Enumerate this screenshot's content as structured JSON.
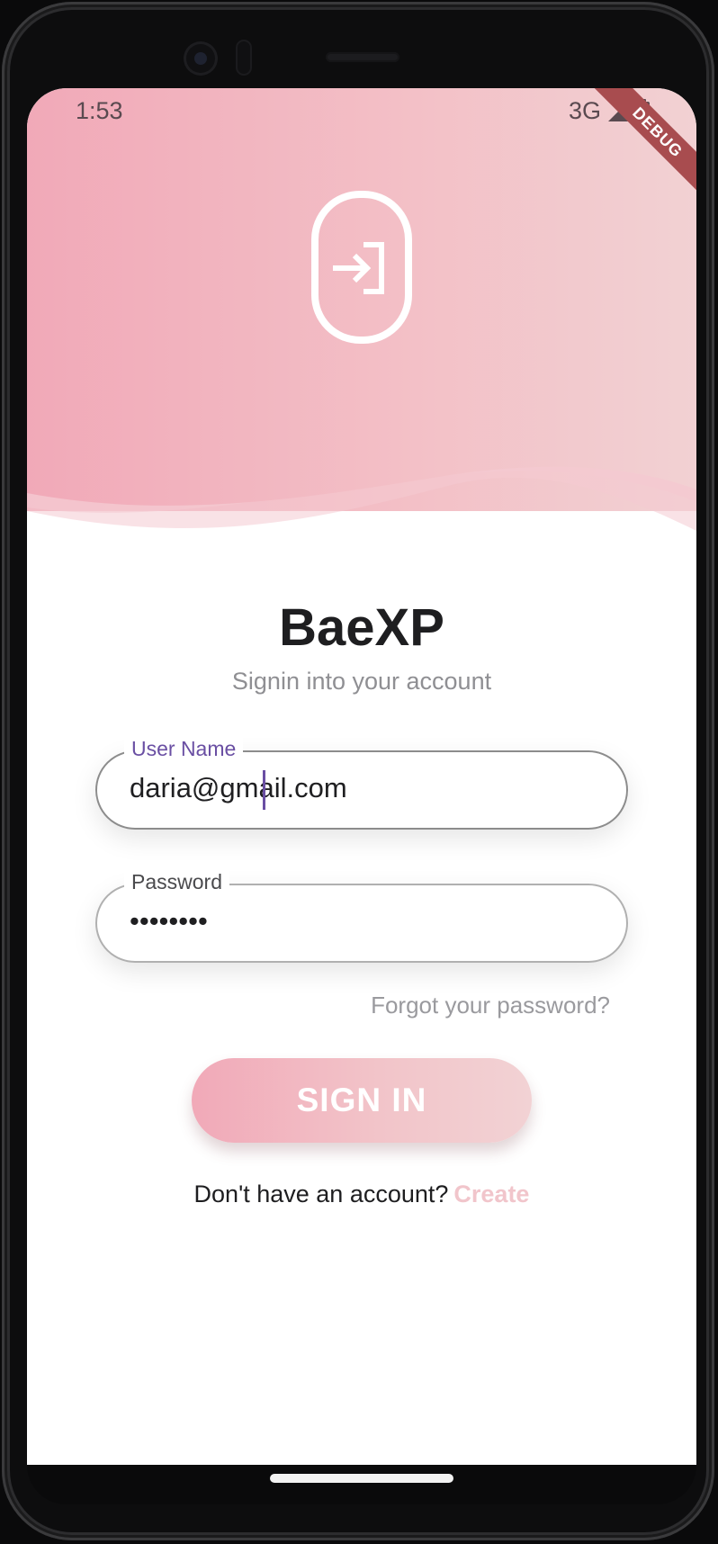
{
  "status_bar": {
    "time": "1:53",
    "network": "3G",
    "debug_banner": "DEBUG"
  },
  "header": {
    "icon": "login-icon",
    "colors": {
      "gradient_start": "#f1a9b8",
      "gradient_end": "#f2d1d3"
    }
  },
  "login": {
    "title": "BaeXP",
    "subtitle": "Signin into your account",
    "username": {
      "label": "User Name",
      "value": "daria@gmail.com",
      "label_color": "#6a4fa3"
    },
    "password": {
      "label": "Password",
      "value": "••••••••",
      "label_color": "#4a4a4d"
    },
    "forgot_password": "Forgot your password?",
    "sign_in_button": "SIGN IN",
    "no_account_text": "Don't have an account?",
    "create_link": "Create"
  }
}
